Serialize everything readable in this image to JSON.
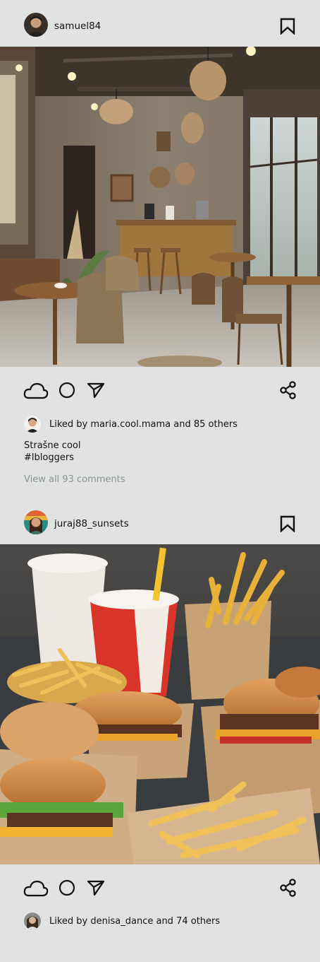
{
  "posts": [
    {
      "username": "samuel84",
      "likes_prefix": "Liked by ",
      "likes_user": "maria.cool.mama",
      "likes_suffix": " and 85 others",
      "caption_line1": "Strašne cool",
      "caption_line2": "#lbloggers",
      "comments_link": "View all 93 comments",
      "photo_subject": "cafe-interior-photo"
    },
    {
      "username": "juraj88_sunsets",
      "likes_prefix": "Liked by ",
      "likes_user": "denisa_dance",
      "likes_suffix": " and 74 others",
      "photo_subject": "burgers-and-fries-photo"
    }
  ],
  "icons": {
    "bookmark": "bookmark-icon",
    "like": "cloud-like-icon",
    "comment": "circle-comment-icon",
    "send": "send-icon",
    "share": "share-icon"
  },
  "colors": {
    "background": "#e1e3e3",
    "text": "#111111",
    "muted": "#8e9191"
  }
}
